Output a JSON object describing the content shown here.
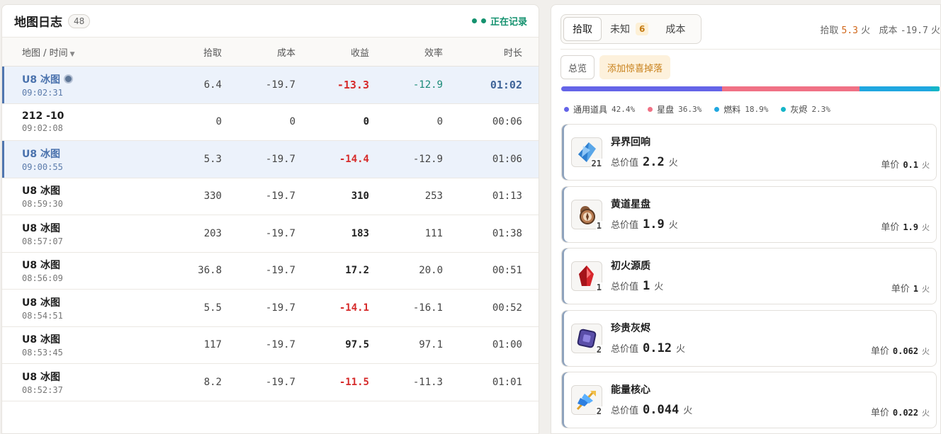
{
  "log": {
    "title": "地图日志",
    "count": "48",
    "status": "正在记录",
    "columns": {
      "name": "地图 / 时间",
      "pick": "拾取",
      "cost": "成本",
      "profit": "收益",
      "efficiency": "效率",
      "duration": "时长"
    },
    "rows": [
      {
        "name": "U8 冰图",
        "time": "09:02:31",
        "pick": "6.4",
        "cost": "-19.7",
        "profit": "-13.3",
        "efficiency": "-12.9",
        "duration": "01:02"
      },
      {
        "name": "212 -10",
        "time": "09:02:08",
        "pick": "0",
        "cost": "0",
        "profit": "0",
        "efficiency": "0",
        "duration": "00:06"
      },
      {
        "name": "U8 冰图",
        "time": "09:00:55",
        "pick": "5.3",
        "cost": "-19.7",
        "profit": "-14.4",
        "efficiency": "-12.9",
        "duration": "01:06"
      },
      {
        "name": "U8 冰图",
        "time": "08:59:30",
        "pick": "330",
        "cost": "-19.7",
        "profit": "310",
        "efficiency": "253",
        "duration": "01:13"
      },
      {
        "name": "U8 冰图",
        "time": "08:57:07",
        "pick": "203",
        "cost": "-19.7",
        "profit": "183",
        "efficiency": "111",
        "duration": "01:38"
      },
      {
        "name": "U8 冰图",
        "time": "08:56:09",
        "pick": "36.8",
        "cost": "-19.7",
        "profit": "17.2",
        "efficiency": "20.0",
        "duration": "00:51"
      },
      {
        "name": "U8 冰图",
        "time": "08:54:51",
        "pick": "5.5",
        "cost": "-19.7",
        "profit": "-14.1",
        "efficiency": "-16.1",
        "duration": "00:52"
      },
      {
        "name": "U8 冰图",
        "time": "08:53:45",
        "pick": "117",
        "cost": "-19.7",
        "profit": "97.5",
        "efficiency": "97.1",
        "duration": "01:00"
      },
      {
        "name": "U8 冰图",
        "time": "08:52:37",
        "pick": "8.2",
        "cost": "-19.7",
        "profit": "-11.5",
        "efficiency": "-11.3",
        "duration": "01:01"
      }
    ]
  },
  "detail": {
    "tabs": {
      "pick": "拾取",
      "unknown": "未知",
      "unknown_badge": "6",
      "cost": "成本"
    },
    "summary": {
      "pick_label": "拾取",
      "pick_value": "5.3",
      "cost_label": "成本",
      "cost_value": "-19.7",
      "unit": "火"
    },
    "overview_btn": "总览",
    "add_btn": "添加惊喜掉落",
    "breakdown": [
      {
        "label": "通用道具",
        "pct": "42.4%",
        "value": 42.4,
        "color": "#6464e8"
      },
      {
        "label": "星盘",
        "pct": "36.3%",
        "value": 36.3,
        "color": "#f07185"
      },
      {
        "label": "燃料",
        "pct": "18.9%",
        "value": 18.9,
        "color": "#20a7e0"
      },
      {
        "label": "灰烬",
        "pct": "2.3%",
        "value": 2.3,
        "color": "#16b5c8"
      }
    ],
    "total_label": "总价值",
    "unit_label": "单价",
    "fire": "火",
    "items": [
      {
        "name": "异界回响",
        "qty": "21",
        "total": "2.2",
        "unit": "0.1",
        "icon": "crystal-shard-icon"
      },
      {
        "name": "黄道星盘",
        "qty": "1",
        "total": "1.9",
        "unit": "1.9",
        "icon": "compass-icon"
      },
      {
        "name": "初火源质",
        "qty": "1",
        "total": "1",
        "unit": "1",
        "icon": "red-crystal-icon"
      },
      {
        "name": "珍贵灰烬",
        "qty": "2",
        "total": "0.12",
        "unit": "0.062",
        "icon": "ember-cube-icon"
      },
      {
        "name": "能量核心",
        "qty": "2",
        "total": "0.044",
        "unit": "0.022",
        "icon": "energy-core-icon"
      }
    ]
  }
}
